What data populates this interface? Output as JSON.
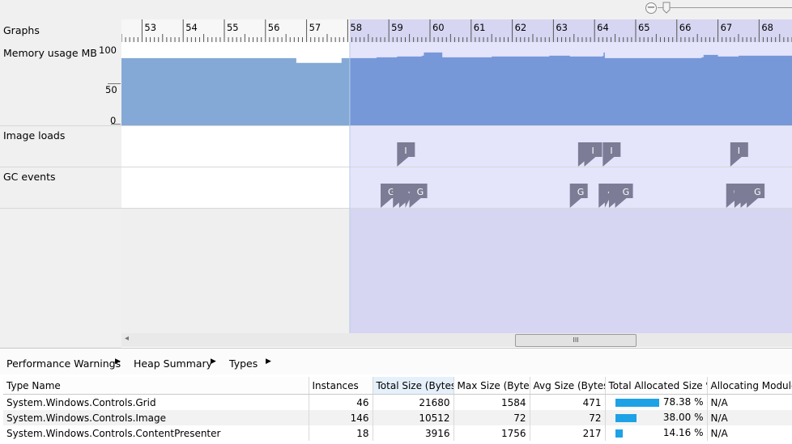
{
  "zoom": {
    "minus_glyph": "−"
  },
  "labels": {
    "graphs": "Graphs",
    "memory": "Memory usage MB",
    "image_loads": "Image loads",
    "gc_events": "GC events"
  },
  "memory_axis": {
    "max": "100",
    "mid": "50",
    "min": "0"
  },
  "ruler_ticks": [
    "53",
    "54",
    "55",
    "56",
    "57",
    "58",
    "59",
    "60",
    "61",
    "62",
    "63",
    "64",
    "65",
    "66",
    "67",
    "68"
  ],
  "chart_data": {
    "type": "area",
    "ylabel": "Memory usage MB",
    "ylim": [
      0,
      100
    ],
    "x_range": [
      52.5,
      68.8
    ],
    "selection_range": [
      58.05,
      68.8
    ],
    "series": [
      {
        "x": [
          52.5,
          56.7,
          56.75,
          57.8,
          57.85,
          58.1,
          58.7,
          59.2,
          59.8,
          59.85,
          60.3,
          61.5,
          62.0,
          62.9,
          63.4,
          63.8,
          64.2,
          64.22,
          64.25,
          65.0,
          66.6,
          66.65,
          67.0,
          67.5,
          68.8
        ],
        "values": [
          84,
          84,
          78,
          78,
          84,
          84,
          85,
          86,
          87,
          91,
          85,
          86,
          86,
          87,
          86,
          86,
          87,
          91,
          84,
          84,
          85,
          88,
          86,
          87,
          88
        ]
      }
    ],
    "image_loads": [
      59.2,
      63.6,
      63.75,
      64.2,
      67.3
    ],
    "gc_events": [
      58.8,
      59.1,
      59.25,
      59.4,
      59.5,
      63.4,
      64.1,
      64.25,
      64.35,
      64.5,
      67.2,
      67.4,
      67.55,
      67.7
    ]
  },
  "event_glyphs": {
    "image": "I",
    "gc": "G",
    "gc_mini": "‹"
  },
  "scrollbar": {
    "left_arrow": "◂",
    "grip": "III"
  },
  "breadcrumb": {
    "items": [
      "Performance Warnings",
      "Heap Summary",
      "Types"
    ],
    "arrow": "▶"
  },
  "table": {
    "headers": [
      "Type Name",
      "Instances",
      "Total Size (Bytes)",
      "Max Size (Bytes)",
      "Avg Size (Bytes)",
      "Total Allocated Size %",
      "Allocating Module"
    ],
    "rows": [
      {
        "type": "System.Windows.Controls.Grid",
        "instances": "46",
        "total": "21680",
        "max": "1584",
        "avg": "471",
        "pct": "78.38 %",
        "pct_value": 78.38,
        "module": "N/A"
      },
      {
        "type": "System.Windows.Controls.Image",
        "instances": "146",
        "total": "10512",
        "max": "72",
        "avg": "72",
        "pct": "38.00 %",
        "pct_value": 38.0,
        "module": "N/A"
      },
      {
        "type": "System.Windows.Controls.ContentPresenter",
        "instances": "18",
        "total": "3916",
        "max": "1756",
        "avg": "217",
        "pct": "14.16 %",
        "pct_value": 14.16,
        "module": "N/A"
      }
    ]
  },
  "colors": {
    "memory_fill": "#84a9d6",
    "memory_fill_selected": "#7698d9",
    "selection": "#d6d6f2",
    "selection_row": "#e4e4fb",
    "marker": "#7c7c96",
    "bar": "#1ea2e6"
  }
}
